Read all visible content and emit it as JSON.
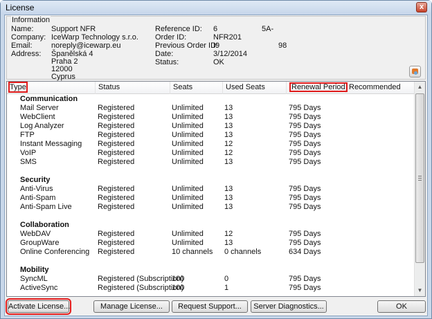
{
  "window": {
    "title": "License",
    "close_glyph": "x"
  },
  "info": {
    "legend": "Information",
    "name_label": "Name:",
    "name": "Support NFR",
    "company_label": "Company:",
    "company": "IceWarp Technology s.r.o.",
    "email_label": "Email:",
    "email": "noreply@icewarp.eu",
    "address_label": "Address:",
    "address": [
      "Španělská 4",
      "Praha 2",
      "12000",
      "Cyprus"
    ],
    "reference_label": "Reference ID:",
    "reference_id": "6",
    "reference_extra": "5A-",
    "order_label": "Order ID:",
    "order_id": "NFR201",
    "prev_order_label": "Previous Order ID:",
    "prev_order_id": "I9",
    "prev_order_extra": "98",
    "date_label": "Date:",
    "date": "3/12/2014",
    "status_label": "Status:",
    "status": "OK",
    "icon": "certificate-icon"
  },
  "columns": [
    "Type",
    "Status",
    "Seats",
    "Used Seats",
    "Renewal Period",
    "Recommended"
  ],
  "rows": [
    {
      "group": "Communication"
    },
    {
      "type": "Mail Server",
      "status": "Registered",
      "seats": "Unlimited",
      "used": "13",
      "renewal": "795 Days",
      "recommended": ""
    },
    {
      "type": "WebClient",
      "status": "Registered",
      "seats": "Unlimited",
      "used": "13",
      "renewal": "795 Days",
      "recommended": ""
    },
    {
      "type": "Log Analyzer",
      "status": "Registered",
      "seats": "Unlimited",
      "used": "13",
      "renewal": "795 Days",
      "recommended": ""
    },
    {
      "type": "FTP",
      "status": "Registered",
      "seats": "Unlimited",
      "used": "13",
      "renewal": "795 Days",
      "recommended": ""
    },
    {
      "type": "Instant Messaging",
      "status": "Registered",
      "seats": "Unlimited",
      "used": "12",
      "renewal": "795 Days",
      "recommended": ""
    },
    {
      "type": "VoIP",
      "status": "Registered",
      "seats": "Unlimited",
      "used": "12",
      "renewal": "795 Days",
      "recommended": ""
    },
    {
      "type": "SMS",
      "status": "Registered",
      "seats": "Unlimited",
      "used": "13",
      "renewal": "795 Days",
      "recommended": ""
    },
    {
      "blank": true
    },
    {
      "group": "Security"
    },
    {
      "type": "Anti-Virus",
      "status": "Registered",
      "seats": "Unlimited",
      "used": "13",
      "renewal": "795 Days",
      "recommended": ""
    },
    {
      "type": "Anti-Spam",
      "status": "Registered",
      "seats": "Unlimited",
      "used": "13",
      "renewal": "795 Days",
      "recommended": ""
    },
    {
      "type": "Anti-Spam Live",
      "status": "Registered",
      "seats": "Unlimited",
      "used": "13",
      "renewal": "795 Days",
      "recommended": ""
    },
    {
      "blank": true
    },
    {
      "group": "Collaboration"
    },
    {
      "type": "WebDAV",
      "status": "Registered",
      "seats": "Unlimited",
      "used": "12",
      "renewal": "795 Days",
      "recommended": ""
    },
    {
      "type": "GroupWare",
      "status": "Registered",
      "seats": "Unlimited",
      "used": "13",
      "renewal": "795 Days",
      "recommended": ""
    },
    {
      "type": "Online Conferencing",
      "status": "Registered",
      "seats": "10 channels",
      "used": "0 channels",
      "renewal": "634 Days",
      "recommended": ""
    },
    {
      "blank": true
    },
    {
      "group": "Mobility"
    },
    {
      "type": "SyncML",
      "status": "Registered (Subscription)",
      "seats": "100",
      "used": "0",
      "renewal": "795 Days",
      "recommended": ""
    },
    {
      "type": "ActiveSync",
      "status": "Registered (Subscription)",
      "seats": "100",
      "used": "1",
      "renewal": "795 Days",
      "recommended": ""
    }
  ],
  "scrollbar": {
    "up": "▲",
    "down": "▼"
  },
  "buttons": {
    "activate": "Activate License...",
    "manage": "Manage License...",
    "support": "Request Support...",
    "diagnostics": "Server Diagnostics...",
    "ok": "OK"
  },
  "colors": {
    "highlight": "#e01b1b",
    "window_frame": "#c9d8ea"
  }
}
